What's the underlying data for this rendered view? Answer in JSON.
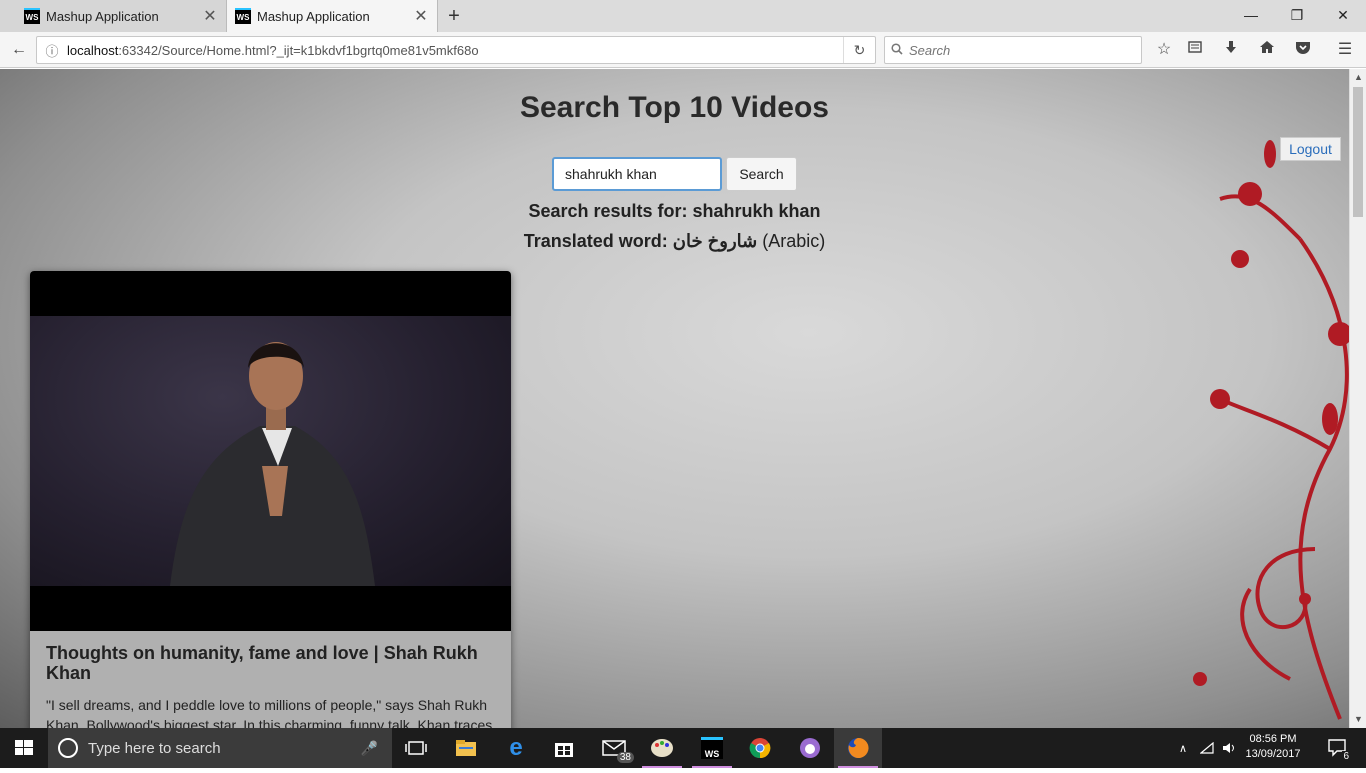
{
  "browser": {
    "tabs": [
      {
        "label": "Mashup Application",
        "favicon": "WS"
      },
      {
        "label": "Mashup Application",
        "favicon": "WS"
      }
    ],
    "url_host": "localhost",
    "url_path": ":63342/Source/Home.html?_ijt=k1bkdvf1bgrtq0me81v5mkf68o",
    "search_placeholder": "Search"
  },
  "page": {
    "title": "Search Top 10 Videos",
    "logout_label": "Logout",
    "search_value": "shahrukh khan",
    "search_button": "Search",
    "results_label": "Search results for: shahrukh khan",
    "translated_prefix": "Translated word: شاروخ خان",
    "translated_suffix": "(Arabic)",
    "videos": [
      {
        "title": "Thoughts on humanity, fame and love | Shah Rukh Khan",
        "description": "\"I sell dreams, and I peddle love to millions of people,\" says Shah Rukh Khan, Bollywood's biggest star. In this charming, funny talk, Khan traces"
      }
    ]
  },
  "taskbar": {
    "search_placeholder": "Type here to search",
    "mail_badge": "38",
    "time": "08:56 PM",
    "date": "13/09/2017",
    "notifications": "6"
  },
  "colors": {
    "accent": "#2a6dbb",
    "input_focus": "#5b9bd5",
    "floral": "#b01b24"
  }
}
